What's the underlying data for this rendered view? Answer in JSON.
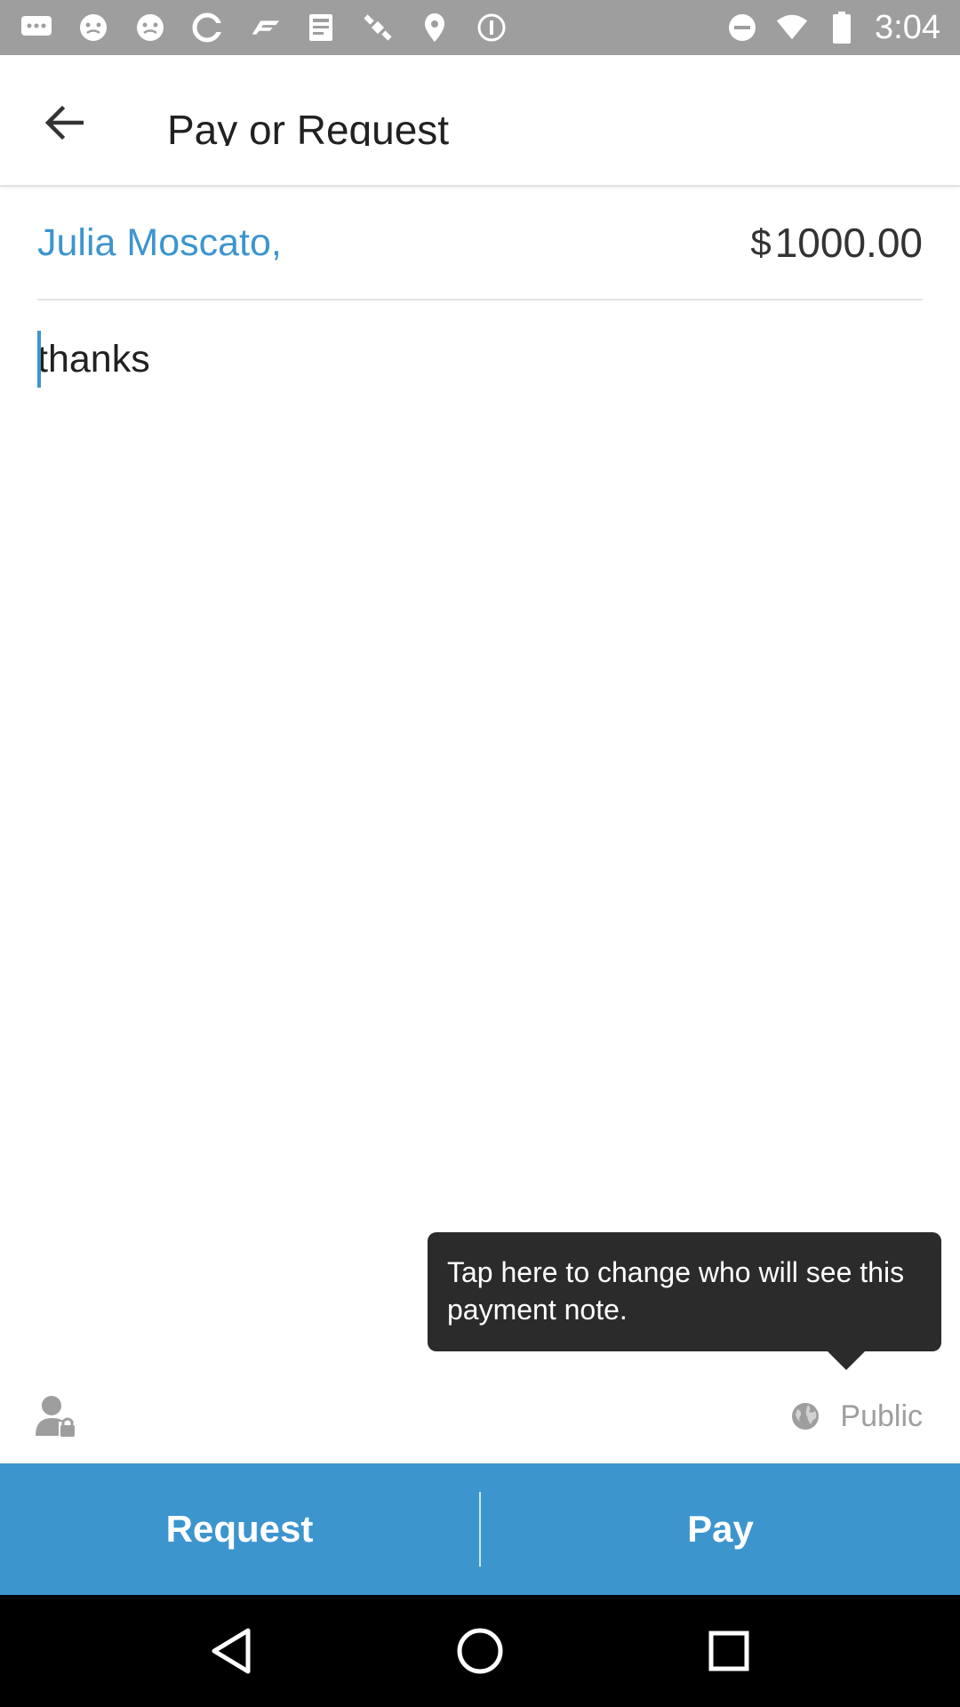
{
  "status_bar": {
    "time": "3:04",
    "icons": [
      "messages-icon",
      "face-icon",
      "face-icon",
      "cast-icon",
      "f1-icon",
      "news-icon",
      "satellite-icon",
      "gps-icon",
      "vpn-icon",
      "dnd-icon",
      "wifi-icon",
      "battery-icon"
    ]
  },
  "app_bar": {
    "title": "Pay or Request",
    "back_icon": "arrow-back-icon"
  },
  "payment": {
    "recipient": "Julia Moscato,",
    "currency": "$",
    "amount": "1000.00"
  },
  "note": {
    "text": "thanks"
  },
  "tooltip": {
    "text": "Tap here to change who will see this payment note."
  },
  "audience": {
    "privacy_icon": "person-lock-icon",
    "globe_icon": "globe-icon",
    "label": "Public"
  },
  "actions": {
    "request_label": "Request",
    "pay_label": "Pay"
  },
  "nav_bar": {
    "icons": [
      "back-triangle-icon",
      "home-circle-icon",
      "recents-square-icon"
    ]
  },
  "colors": {
    "accent": "#3d95ce",
    "tooltip_bg": "#2b2b2b",
    "status_bar": "#9e9e9e",
    "nav_bar": "#000000"
  }
}
